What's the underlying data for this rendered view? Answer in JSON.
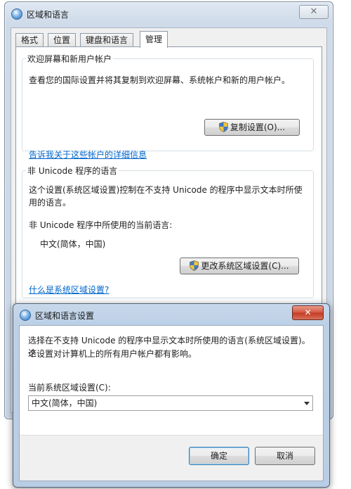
{
  "main_window": {
    "title": "区域和语言",
    "close_glyph": "✕",
    "tabs": [
      "格式",
      "位置",
      "键盘和语言",
      "管理"
    ],
    "active_tab": "管理",
    "welcome_group": {
      "legend": "欢迎屏幕和新用户帐户",
      "description": "查看您的国际设置并将其复制到欢迎屏幕、系统帐户和新的用户帐户。",
      "copy_button": "复制设置(O)...",
      "link": "告诉我关于这些帐户的详细信息"
    },
    "unicode_group": {
      "legend": "非 Unicode 程序的语言",
      "description_line1": "这个设置(系统区域设置)控制在不支持 Unicode 的程序中显示文本时所使",
      "description_line2": "用的语言。",
      "current_label": "非 Unicode 程序中所使用的当前语言:",
      "current_value": "中文(简体，中国)",
      "change_button": "更改系统区域设置(C)...",
      "link": "什么是系统区域设置?"
    }
  },
  "dialog": {
    "title": "区域和语言设置",
    "close_glyph": "✕",
    "description_line1": "选择在不支持 Unicode 的程序中显示文本时所使用的语言(系统区域设置)。这",
    "description_line2": "个设置对计算机上的所有用户帐户都有影响。",
    "select_label": "当前系统区域设置(C):",
    "select_value": "中文(简体，中国)",
    "ok_button": "确定",
    "cancel_button": "取消"
  },
  "icons": {
    "window_icon": "globe-icon",
    "shield_icon": "uac-shield-icon",
    "dropdown_icon": "chevron-down-icon"
  },
  "colors": {
    "link": "#0066cc",
    "titlebar": "#cfdbe9",
    "dialog_close": "#c23a22"
  }
}
